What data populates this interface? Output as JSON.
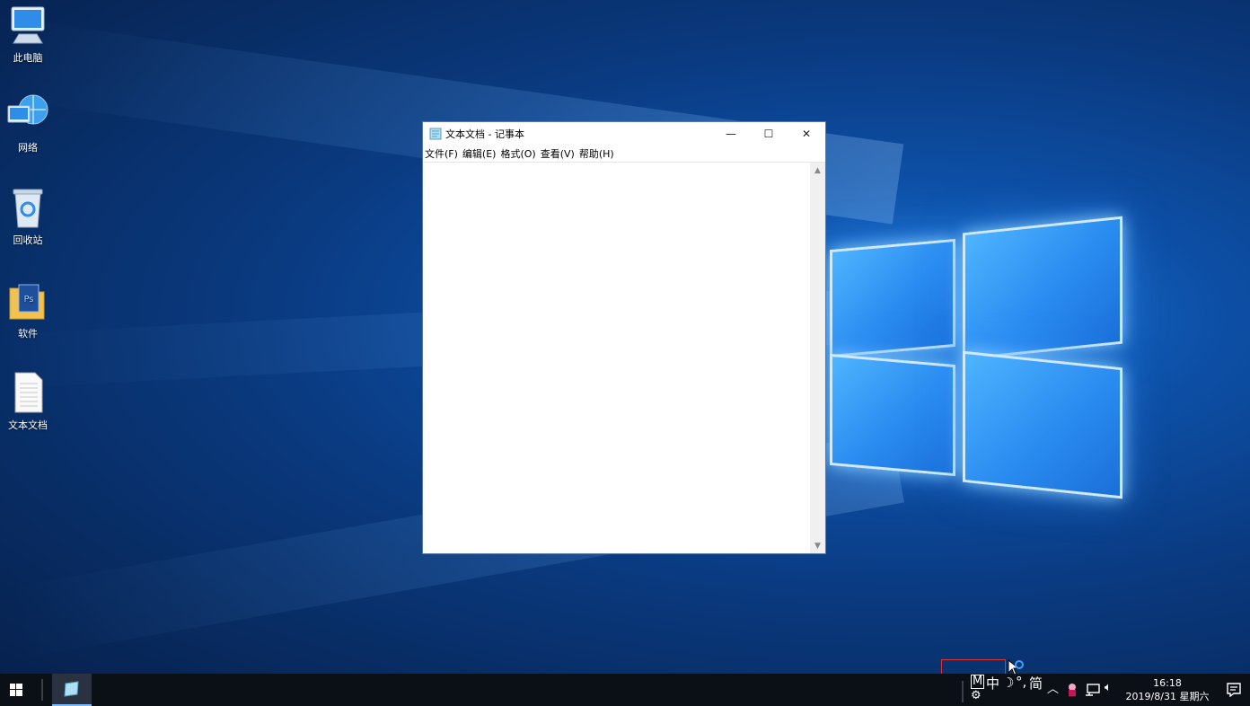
{
  "desktop": {
    "icons": [
      {
        "label": "此电脑",
        "icon": "computer-icon"
      },
      {
        "label": "网络",
        "icon": "network-icon"
      },
      {
        "label": "回收站",
        "icon": "recycle-bin-icon"
      },
      {
        "label": "软件",
        "icon": "folder-icon"
      },
      {
        "label": "文本文档",
        "icon": "text-document-icon"
      }
    ]
  },
  "notepad": {
    "title": "文本文档 - 记事本",
    "controls": {
      "minimize": "—",
      "maximize": "☐",
      "close": "✕"
    },
    "menu": [
      "文件(F)",
      "编辑(E)",
      "格式(O)",
      "查看(V)",
      "帮助(H)"
    ],
    "content": ""
  },
  "taskbar": {
    "ime": {
      "mode": "M",
      "lang": "中",
      "punct": "°,",
      "script": "简"
    },
    "clock": {
      "time": "16:18",
      "date": "2019/8/31 星期六"
    }
  },
  "colors": {
    "accent": "#1a6fd9",
    "taskbar": "#0b0f16",
    "highlight": "#e03131"
  }
}
